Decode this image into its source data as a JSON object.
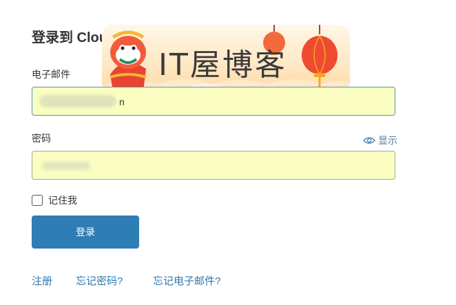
{
  "header": {
    "title": "登录到 Cloudfl"
  },
  "banner": {
    "brand_text": "IT屋博客"
  },
  "form": {
    "email_label": "电子邮件",
    "email_visible_suffix": "n",
    "password_label": "密码",
    "show_password_label": "显示",
    "remember_me_label": "记住我",
    "login_button_label": "登录"
  },
  "links": {
    "register": "注册",
    "forgot_password": "忘记密码?",
    "forgot_email": "忘记电子邮件?"
  },
  "colors": {
    "accent": "#2e7db5",
    "input_autofill_bg": "#fafec0",
    "link": "#2e79b0"
  }
}
